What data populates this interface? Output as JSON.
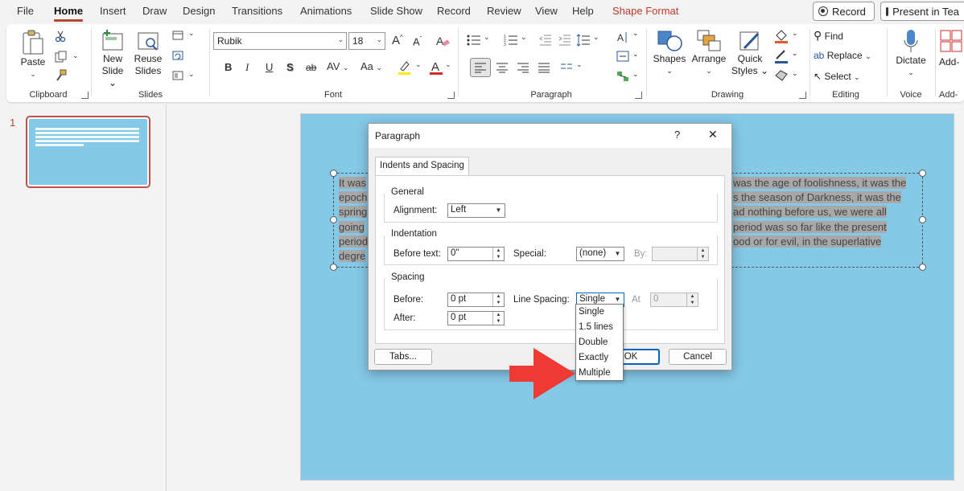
{
  "menu": {
    "items": [
      "File",
      "Home",
      "Insert",
      "Draw",
      "Design",
      "Transitions",
      "Animations",
      "Slide Show",
      "Record",
      "Review",
      "View",
      "Help",
      "Shape Format"
    ],
    "active": "Home",
    "record_button": "Record",
    "present_button": "Present in Tea"
  },
  "ribbon": {
    "clipboard": {
      "label": "Clipboard",
      "paste": "Paste"
    },
    "slides": {
      "label": "Slides",
      "new_slide_1": "New",
      "new_slide_2": "Slide",
      "reuse_1": "Reuse",
      "reuse_2": "Slides"
    },
    "font": {
      "label": "Font",
      "font_name": "Rubik",
      "font_size": "18",
      "grow": "A",
      "shrink": "A",
      "bold": "B",
      "italic": "I",
      "underline": "U",
      "shadow": "S",
      "strike": "ab",
      "spacing": "AV",
      "case": "Aa"
    },
    "paragraph": {
      "label": "Paragraph"
    },
    "drawing": {
      "label": "Drawing",
      "shapes": "Shapes",
      "arrange": "Arrange",
      "quick_styles_1": "Quick",
      "quick_styles_2": "Styles"
    },
    "editing": {
      "label": "Editing",
      "find": "Find",
      "replace": "Replace",
      "select": "Select"
    },
    "voice": {
      "label": "Voice",
      "dictate": "Dictate"
    },
    "addins": {
      "label": "Add-",
      "add": "Add-"
    }
  },
  "thumbnails": [
    {
      "number": "1"
    }
  ],
  "slide": {
    "text_lines": [
      {
        "left": "It was",
        "right": "was the age of foolishness, it was the"
      },
      {
        "left": "epoch",
        "right": "s the season of Darkness, it was the"
      },
      {
        "left": "spring",
        "right": "ad nothing before us, we were all"
      },
      {
        "left": "going",
        "right": "period was so far like the present"
      },
      {
        "left": "period",
        "right": "ood or for evil, in the superlative"
      },
      {
        "left": "degre",
        "right": ""
      }
    ]
  },
  "dialog": {
    "title": "Paragraph",
    "help": "?",
    "close": "✕",
    "tab": "Indents and Spacing",
    "general": {
      "legend": "General",
      "alignment_label": "Alignment:",
      "alignment_value": "Left"
    },
    "indentation": {
      "legend": "Indentation",
      "before_text_label": "Before text:",
      "before_text_value": "0\"",
      "special_label": "Special:",
      "special_value": "(none)",
      "by_label": "By:",
      "by_value": ""
    },
    "spacing": {
      "legend": "Spacing",
      "before_label": "Before:",
      "before_value": "0 pt",
      "after_label": "After:",
      "after_value": "0 pt",
      "line_spacing_label": "Line Spacing:",
      "line_spacing_value": "Single",
      "at_label": "At",
      "at_value": "0"
    },
    "tabs_button": "Tabs...",
    "ok_button": "OK",
    "cancel_button": "Cancel"
  },
  "line_spacing_options": [
    "Single",
    "1.5 lines",
    "Double",
    "Exactly",
    "Multiple"
  ],
  "colors": {
    "accent": "#b7472a",
    "slide_bg": "#85c9e8",
    "arrow": "#ee3a33",
    "focus": "#0067c0"
  }
}
